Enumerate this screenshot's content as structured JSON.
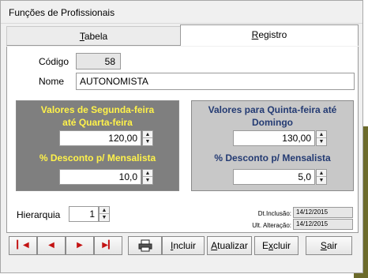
{
  "window": {
    "title": "Funções de Profissionais"
  },
  "tabs": [
    {
      "label": "Tabela",
      "accel": "T",
      "rest": "abela",
      "active": false
    },
    {
      "label": "Registro",
      "accel": "R",
      "rest": "egistro",
      "active": true
    }
  ],
  "form": {
    "codigo_label": "Código",
    "codigo_value": "58",
    "nome_label": "Nome",
    "nome_value": "AUTONOMISTA"
  },
  "weekday_box": {
    "title_line1": "Valores de Segunda-feira",
    "title_line2": "até Quarta-feira",
    "value": "120,00",
    "discount_label": "%  Desconto p/ Mensalista",
    "discount_value": "10,0",
    "title_color": "#fff24a",
    "background": "#7f7f7f"
  },
  "weekend_box": {
    "title_line1": "Valores para Quinta-feira até",
    "title_line2": "Domingo",
    "value": "130,00",
    "discount_label": "%  Desconto p/ Mensalista",
    "discount_value": "5,0",
    "title_color": "#243b73",
    "background": "#c8c8c8"
  },
  "hierarquia": {
    "label": "Hierarquia",
    "value": "1"
  },
  "audit": {
    "inclusao_label": "Dt.Inclusão:",
    "inclusao_value": "14/12/2015",
    "alteracao_label": "Ult. Alteração:",
    "alteracao_value": "14/12/2015"
  },
  "toolbar": {
    "first_icon": "first-record-icon",
    "prev_icon": "previous-record-icon",
    "next_icon": "next-record-icon",
    "last_icon": "last-record-icon",
    "print_icon": "printer-icon",
    "incluir": {
      "accel": "I",
      "rest": "ncluir"
    },
    "atualizar": {
      "accel": "A",
      "rest": "tualizar"
    },
    "excluir": {
      "pre": "E",
      "accel": "x",
      "rest": "cluir"
    },
    "sair": {
      "accel": "S",
      "rest": "air"
    }
  }
}
